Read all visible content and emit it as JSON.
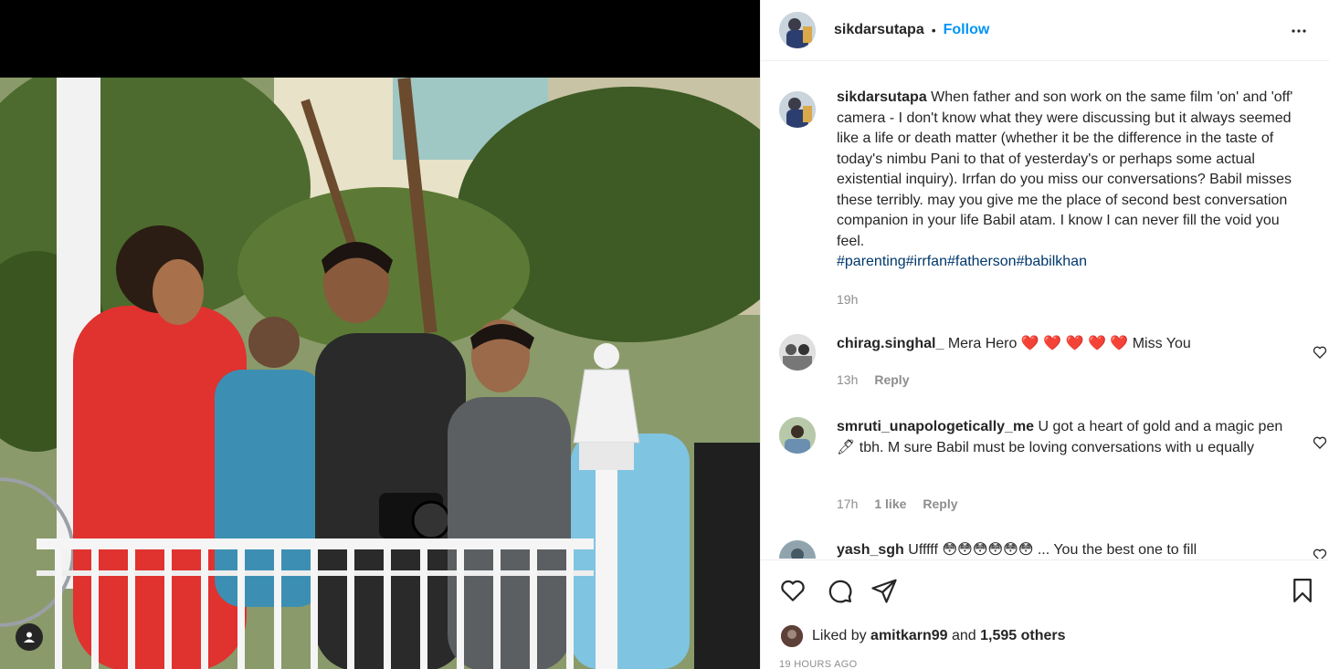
{
  "post": {
    "author": "sikdarsutapa",
    "separator": "•",
    "follow_label": "Follow",
    "more_icon": "more-horizontal-icon"
  },
  "caption": {
    "author": "sikdarsutapa",
    "text": "When father and son work on the same film 'on' and 'off' camera - I don't know what they were discussing but it always seemed like a life or death matter (whether it be the difference in the taste of today's nimbu Pani to that of yesterday's or perhaps some actual existential inquiry). Irrfan do you miss our conversations? Babil misses these terribly. may you give me the place of second best conversation companion in your life Babil atam. I know I can never fill the void you feel.",
    "hashtags": "#parenting#irrfan#fatherson#babilkhan",
    "time": "19h"
  },
  "comments": [
    {
      "author": "chirag.singhal_",
      "text_before": "Mera Hero",
      "emoji": "❤️ ❤️ ❤️ ❤️ ❤️",
      "text_after": "Miss You",
      "time": "13h",
      "likes": "",
      "reply_label": "Reply"
    },
    {
      "author": "smruti_unapologetically_me",
      "text": "U got a heart of gold and a magic pen 🖊 tbh. M sure Babil must be loving conversations with u equally",
      "time": "17h",
      "likes": "1 like",
      "reply_label": "Reply"
    },
    {
      "author": "yash_sgh",
      "text": "Ufffff 😳😳😳😳😳😳 ... You the best one to fill"
    }
  ],
  "actions": {
    "like_icon": "heart-icon",
    "comment_icon": "comment-icon",
    "share_icon": "share-icon",
    "save_icon": "bookmark-icon"
  },
  "likes": {
    "prefix": "Liked by",
    "user": "amitkarn99",
    "middle": "and",
    "others": "1,595 others"
  },
  "timestamp": "19 HOURS AGO",
  "colors": {
    "link_blue": "#0095f6",
    "hashtag": "#00376b",
    "muted": "#8e8e8e",
    "heart_red": "#ed4956"
  }
}
